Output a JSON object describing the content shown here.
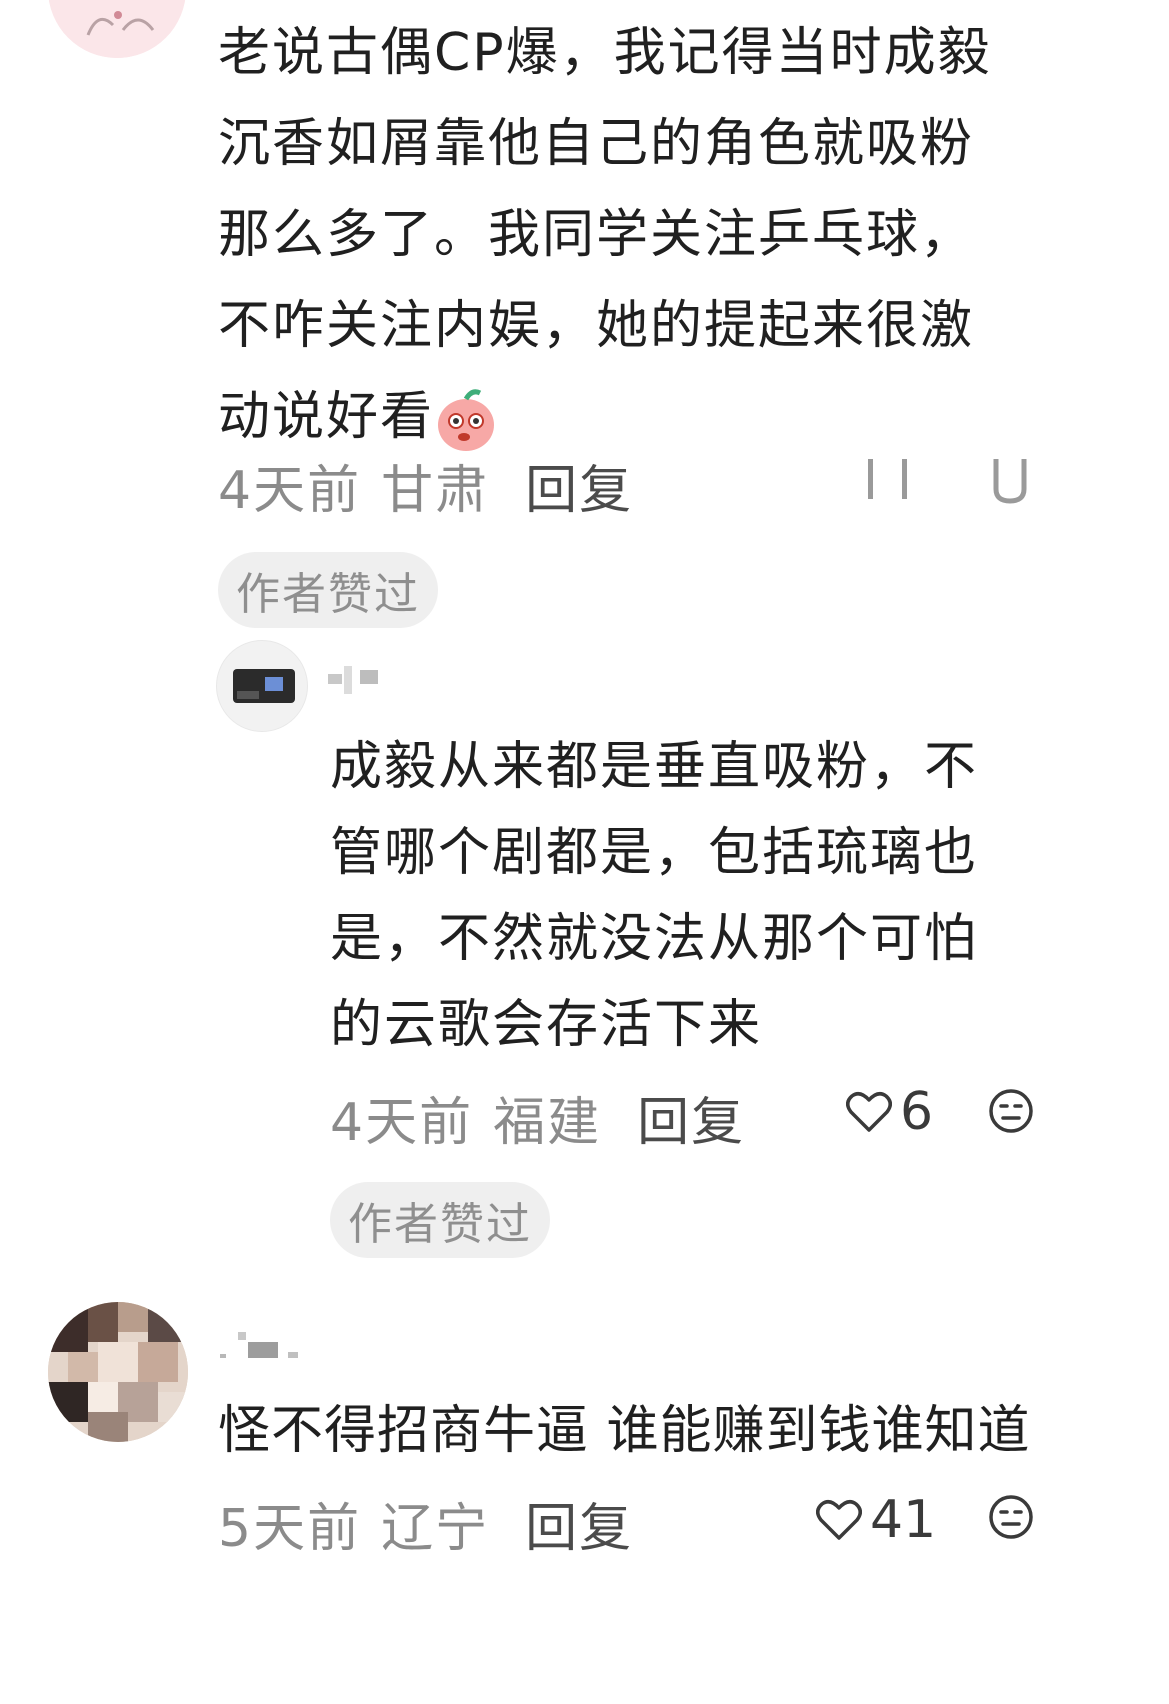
{
  "comments": [
    {
      "text": "老说古偶CP爆，我记得当时成毅沉香如屑靠他自己的角色就吸粉那么多了。我同学关注乒乓球，不咋关注内娱，她的提起来很激动说好看",
      "emoji": "peach-face-emoji",
      "time": "4天前",
      "region": "甘肃",
      "reply_label": "回复",
      "author_liked_label": "作者赞过"
    },
    {
      "text": "成毅从来都是垂直吸粉，不管哪个剧都是，包括琉璃也是，不然就没法从那个可怕的云歌会存活下来",
      "time": "4天前",
      "region": "福建",
      "reply_label": "回复",
      "likes": "6",
      "author_liked_label": "作者赞过"
    },
    {
      "text": "怪不得招商牛逼 谁能赚到钱谁知道",
      "time": "5天前",
      "region": "辽宁",
      "reply_label": "回复",
      "likes": "41"
    }
  ],
  "colors": {
    "text": "#202020",
    "meta": "#8b8b8b",
    "badge_bg": "#efefef"
  }
}
